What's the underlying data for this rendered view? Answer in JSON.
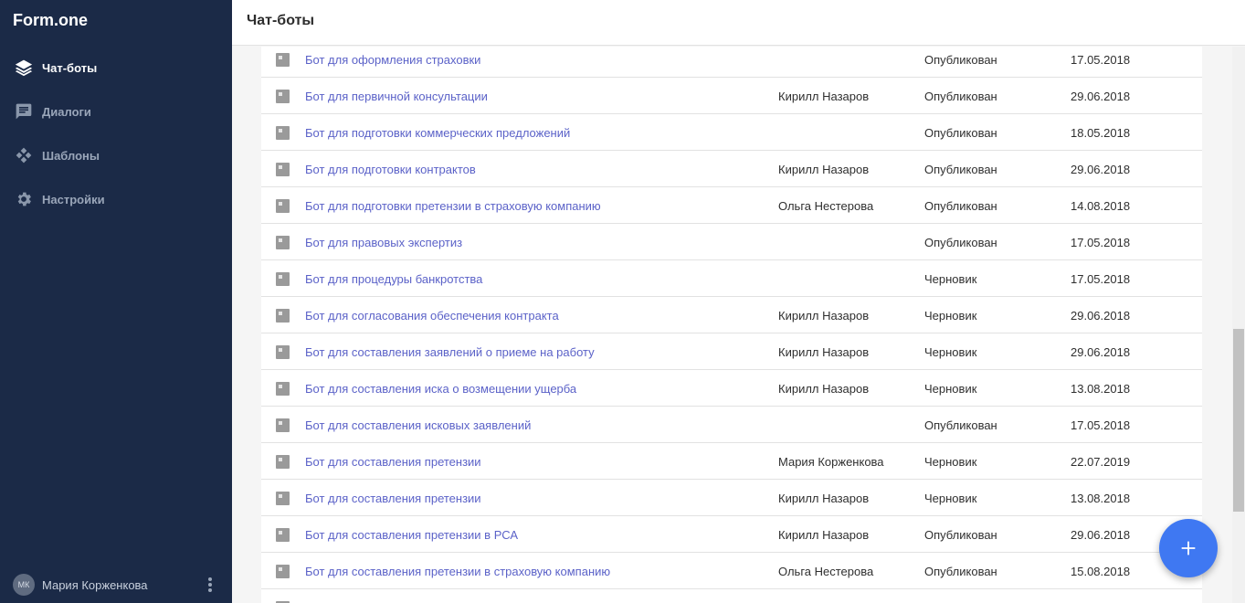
{
  "app": {
    "brand": "Form.one"
  },
  "nav": {
    "items": [
      {
        "label": "Чат-боты",
        "icon": "layers-icon",
        "active": true
      },
      {
        "label": "Диалоги",
        "icon": "chat-icon",
        "active": false
      },
      {
        "label": "Шаблоны",
        "icon": "templates-icon",
        "active": false
      },
      {
        "label": "Настройки",
        "icon": "gear-icon",
        "active": false
      }
    ]
  },
  "header": {
    "title": "Чат-боты"
  },
  "user": {
    "initials": "МК",
    "name": "Мария Корженкова"
  },
  "rows": [
    {
      "title": "Бот для оформления страховки",
      "author": "",
      "status": "Опубликован",
      "date": "17.05.2018"
    },
    {
      "title": "Бот для первичной консультации",
      "author": "Кирилл Назаров",
      "status": "Опубликован",
      "date": "29.06.2018"
    },
    {
      "title": "Бот для подготовки коммерческих предложений",
      "author": "",
      "status": "Опубликован",
      "date": "18.05.2018"
    },
    {
      "title": "Бот для подготовки контрактов",
      "author": "Кирилл Назаров",
      "status": "Опубликован",
      "date": "29.06.2018"
    },
    {
      "title": "Бот для подготовки претензии в страховую компанию",
      "author": "Ольга Нестерова",
      "status": "Опубликован",
      "date": "14.08.2018"
    },
    {
      "title": "Бот для правовых экспертиз",
      "author": "",
      "status": "Опубликован",
      "date": "17.05.2018"
    },
    {
      "title": "Бот для процедуры банкротства",
      "author": "",
      "status": "Черновик",
      "date": "17.05.2018"
    },
    {
      "title": "Бот для согласования обеспечения контракта",
      "author": "Кирилл Назаров",
      "status": "Черновик",
      "date": "29.06.2018"
    },
    {
      "title": "Бот для составления заявлений о приеме на работу",
      "author": "Кирилл Назаров",
      "status": "Черновик",
      "date": "29.06.2018"
    },
    {
      "title": "Бот для составления иска о возмещении ущерба",
      "author": "Кирилл Назаров",
      "status": "Черновик",
      "date": "13.08.2018"
    },
    {
      "title": "Бот для составления исковых заявлений",
      "author": "",
      "status": "Опубликован",
      "date": "17.05.2018"
    },
    {
      "title": "Бот для составления претензии",
      "author": "Мария Корженкова",
      "status": "Черновик",
      "date": "22.07.2019"
    },
    {
      "title": "Бот для составления претензии",
      "author": "Кирилл Назаров",
      "status": "Черновик",
      "date": "13.08.2018"
    },
    {
      "title": "Бот для составления претензии в РСА",
      "author": "Кирилл Назаров",
      "status": "Опубликован",
      "date": "29.06.2018"
    },
    {
      "title": "Бот для составления претензии в страховую компанию",
      "author": "Ольга Нестерова",
      "status": "Опубликован",
      "date": "15.08.2018"
    },
    {
      "title": "",
      "author": "",
      "status": "",
      "date": ""
    }
  ],
  "colors": {
    "sidebar": "#1b2a47",
    "link": "#5b62c8",
    "fab": "#3f78f2"
  },
  "fab": {
    "icon": "plus-icon"
  }
}
